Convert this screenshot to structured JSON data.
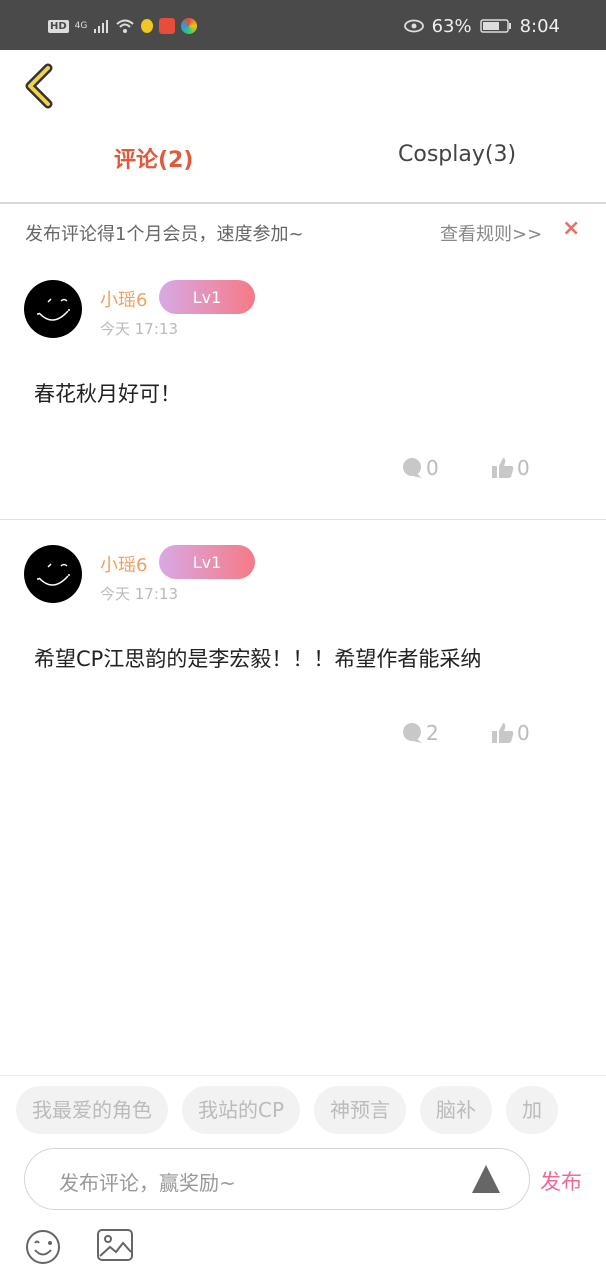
{
  "status_bar": {
    "hd": "HD",
    "network": "4G",
    "battery": "63%",
    "time": "8:04"
  },
  "tabs": [
    {
      "label": "评论(2)",
      "active": true
    },
    {
      "label": "Cosplay(3)",
      "active": false
    }
  ],
  "promo": {
    "text": "发布评论得1个月会员，速度参加~",
    "rules_link": "查看规则>>",
    "close_icon": "×"
  },
  "comments": [
    {
      "username": "小瑶6",
      "level": "Lv1",
      "time": "今天 17:13",
      "text": "春花秋月好可！",
      "replies": "0",
      "likes": "0"
    },
    {
      "username": "小瑶6",
      "level": "Lv1",
      "time": "今天 17:13",
      "text": "希望CP江思韵的是李宏毅！！！希望作者能采纳",
      "replies": "2",
      "likes": "0"
    }
  ],
  "quick_tags": [
    "我最爱的角色",
    "我站的CP",
    "神预言",
    "脑补",
    "加"
  ],
  "input": {
    "placeholder": "发布评论，赢奖励~",
    "publish_label": "发布"
  },
  "colors": {
    "active_tab": "#e25a3c",
    "username": "#f0a060",
    "badge_gradient": [
      "#d8a9e6",
      "#f57a86"
    ],
    "publish": "#f06a94",
    "close": "#e8726a"
  },
  "icons": [
    "back-icon",
    "reply-icon",
    "like-icon",
    "send-icon",
    "emoji-icon",
    "image-icon",
    "close-icon"
  ]
}
